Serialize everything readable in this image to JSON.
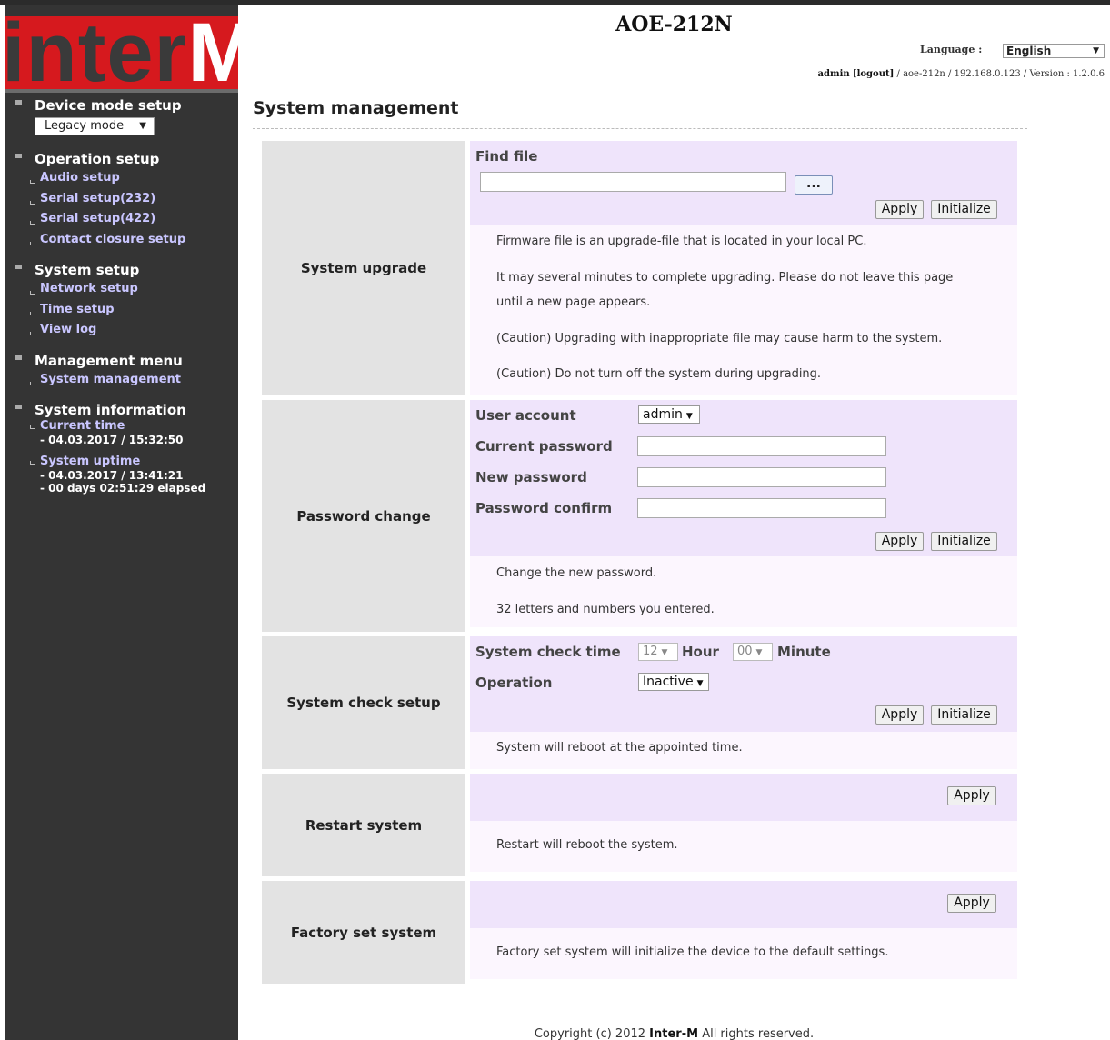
{
  "header": {
    "title": "AOE-212N",
    "language_label": "Language :",
    "language_value": "English",
    "user": "admin",
    "logout": "[logout]",
    "info": "/ aoe-212n / 192.168.0.123 / Version : 1.2.0.6"
  },
  "logo": {
    "text_main": "inter",
    "text_accent": "M"
  },
  "sidebar": {
    "device_mode": {
      "label": "Device mode setup",
      "select_value": "Legacy mode"
    },
    "operation": {
      "label": "Operation setup",
      "items": [
        "Audio setup",
        "Serial setup(232)",
        "Serial setup(422)",
        "Contact closure setup"
      ]
    },
    "system": {
      "label": "System setup",
      "items": [
        "Network setup",
        "Time setup",
        "View log"
      ]
    },
    "management": {
      "label": "Management menu",
      "items": [
        "System management"
      ]
    },
    "info": {
      "label": "System information",
      "current_time_label": "Current time",
      "current_time_value": "- 04.03.2017 / 15:32:50",
      "uptime_label": "System uptime",
      "uptime_start": "- 04.03.2017 / 13:41:21",
      "uptime_elapsed": "- 00 days 02:51:29 elapsed"
    }
  },
  "page": {
    "title": "System management"
  },
  "upgrade": {
    "label": "System upgrade",
    "find_file": "Find file",
    "browse": "...",
    "apply": "Apply",
    "initialize": "Initialize",
    "desc": [
      "Firmware file is an upgrade-file that is located in your local PC.",
      "It may several minutes to complete upgrading. Please do not leave this page",
      "until a new page appears.",
      "(Caution) Upgrading with inappropriate file may cause harm to the system.",
      "(Caution) Do not turn off the system during upgrading."
    ]
  },
  "password": {
    "label": "Password change",
    "user_account": "User account",
    "user_value": "admin",
    "current": "Current password",
    "new": "New password",
    "confirm": "Password confirm",
    "apply": "Apply",
    "initialize": "Initialize",
    "desc": [
      "Change the new password.",
      "32 letters and numbers you entered."
    ]
  },
  "check": {
    "label": "System check setup",
    "time_label": "System check time",
    "hour_value": "12",
    "hour_unit": "Hour",
    "minute_value": "00",
    "minute_unit": "Minute",
    "operation_label": "Operation",
    "operation_value": "Inactive",
    "apply": "Apply",
    "initialize": "Initialize",
    "desc": [
      "System will reboot at the appointed time."
    ]
  },
  "restart": {
    "label": "Restart system",
    "apply": "Apply",
    "desc": [
      "Restart will reboot the system."
    ]
  },
  "factory": {
    "label": "Factory set system",
    "apply": "Apply",
    "desc": [
      "Factory set system will initialize the device to the default settings."
    ]
  },
  "footer": {
    "prefix": "Copyright (c) 2012",
    "brand": "Inter-M",
    "suffix": "All rights reserved."
  }
}
